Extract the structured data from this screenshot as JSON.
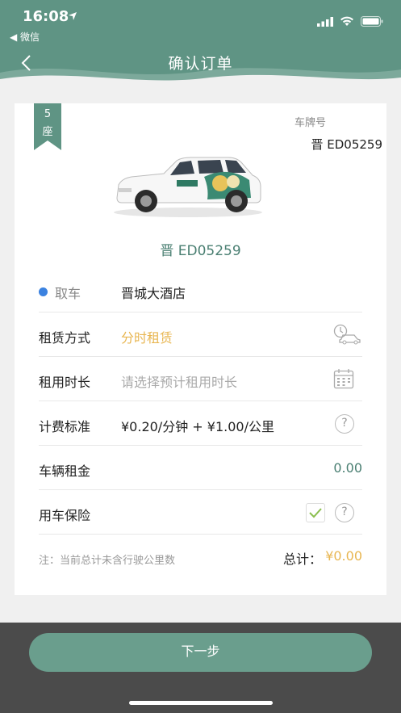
{
  "status_bar": {
    "time": "16:08",
    "back_app": "◀ 微信"
  },
  "nav": {
    "title": "确认订单"
  },
  "vehicle": {
    "seat_count": "5",
    "seat_unit": "座",
    "plate_label": "车牌号",
    "plate_number": "晋 ED05259",
    "plate_number_center": "晋 ED05259"
  },
  "form": {
    "pickup": {
      "label": "取车",
      "value": "晋城大酒店"
    },
    "rental_mode": {
      "label": "租赁方式",
      "value": "分时租赁"
    },
    "duration": {
      "label": "租用时长",
      "placeholder": "请选择预计租用时长"
    },
    "pricing": {
      "label": "计费标准",
      "value": "¥0.20/分钟 + ¥1.00/公里"
    },
    "rent_fee": {
      "label": "车辆租金",
      "value": "0.00"
    },
    "insurance": {
      "label": "用车保险"
    }
  },
  "summary": {
    "note": "注：当前总计未含行驶公里数",
    "total_label": "总计：",
    "total_value": "¥0.00"
  },
  "footer": {
    "next_label": "下一步"
  },
  "colors": {
    "brand": "#5f9484",
    "accent_gold": "#e8b651",
    "pickup_dot": "#3b82e0"
  }
}
